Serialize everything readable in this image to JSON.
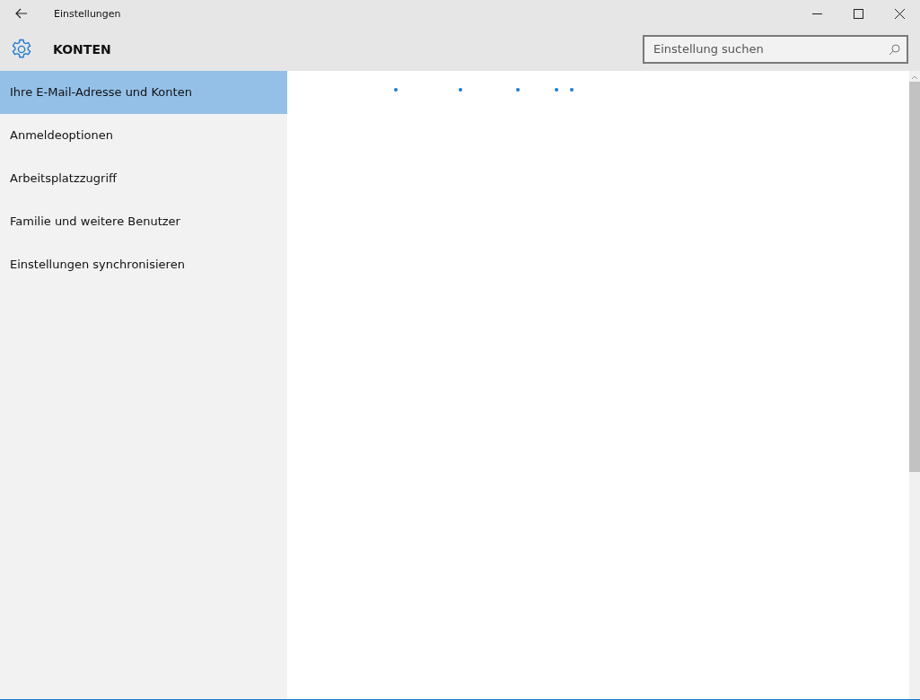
{
  "window": {
    "title": "Einstellungen"
  },
  "header": {
    "title": "KONTEN",
    "search": {
      "placeholder": "Einstellung suchen"
    }
  },
  "sidebar": {
    "items": [
      {
        "label": "Ihre E-Mail-Adresse und Konten",
        "selected": true
      },
      {
        "label": "Anmeldeoptionen",
        "selected": false
      },
      {
        "label": "Arbeitsplatzzugriff",
        "selected": false
      },
      {
        "label": "Familie und weitere Benutzer",
        "selected": false
      },
      {
        "label": "Einstellungen synchronisieren",
        "selected": false
      }
    ]
  }
}
